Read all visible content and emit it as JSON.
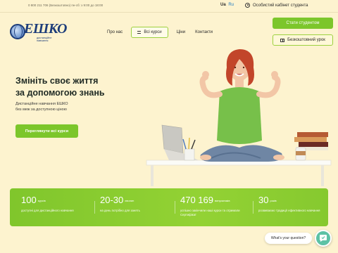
{
  "topbar": {
    "phone": "0 800 211 706 (Безкоштовно) пн-сб: з 9:00 до 18:00",
    "lang_active": "Ua",
    "lang_other": "Ru",
    "cabinet": "Особистий кабінет студента"
  },
  "logo": {
    "word": "ЕШКО",
    "sub": "дистанційне навчання"
  },
  "nav": {
    "about": "Про нас",
    "courses": "Всі курси",
    "prices": "Ціни",
    "contacts": "Контакти"
  },
  "cta": {
    "student": "Стати студентом",
    "free_lesson": "Безкоштовний урок"
  },
  "hero": {
    "title_line1": "Змініть своє життя",
    "title_line2": "за допомогою знань",
    "sub_line1": "Дистанційне навчання ЕШКО",
    "sub_line2": "без меж за доступною ціною",
    "button": "Переглянути всі курси"
  },
  "stats": [
    {
      "value": "100",
      "unit": "курсів",
      "desc": "доступні для дистанційного навчання"
    },
    {
      "value": "20-30",
      "unit": "хвилин",
      "desc": "на день потрібно для занять"
    },
    {
      "value": "470 169",
      "unit": "випускників",
      "desc": "успішно закінчили наші курси та отримали Сертифікат"
    },
    {
      "value": "30",
      "unit": "років",
      "desc": "розвиваємо традиції ефективного навчання"
    }
  ],
  "chat": {
    "bubble": "What's your question?"
  },
  "colors": {
    "accent": "#7cc62b",
    "background": "#fdf3cf",
    "brand": "#1d3d7a",
    "chat": "#5cc2a5"
  }
}
